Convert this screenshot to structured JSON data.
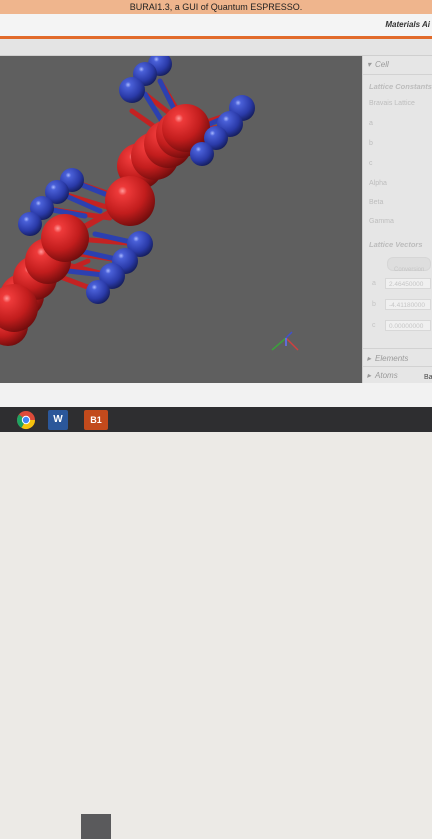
{
  "window": {
    "title": "BURAI1.3, a GUI of Quantum ESPRESSO.",
    "brand": "Materials Ai"
  },
  "side_panel": {
    "cell_header": "Cell",
    "lattice_constants_header": "Lattice Constants",
    "bravais_label": "Bravais Lattice",
    "a_label": "a",
    "b_label": "b",
    "c_label": "c",
    "alpha_label": "Alpha",
    "beta_label": "Beta",
    "gamma_label": "Gamma",
    "lattice_vectors_header": "Lattice Vectors",
    "vector_button": "Conversion",
    "vectors": [
      {
        "label": "a",
        "value": "2.46450000"
      },
      {
        "label": "b",
        "value": "-4.41180000"
      },
      {
        "label": "c",
        "value": "0.00000000"
      }
    ],
    "elements_header": "Elements",
    "atoms_header": "Atoms",
    "back_button": "Ba"
  },
  "taskbar": {
    "apps": [
      {
        "name": "chrome",
        "label": ""
      },
      {
        "name": "word",
        "label": "W"
      },
      {
        "name": "burai",
        "label": "B1"
      }
    ]
  },
  "colors": {
    "title_bar": "#efb58d",
    "accent": "#e16a2a",
    "viewer_bg": "#5f5f5f",
    "atom_red": "#cc2020",
    "atom_blue": "#2f45b8"
  }
}
